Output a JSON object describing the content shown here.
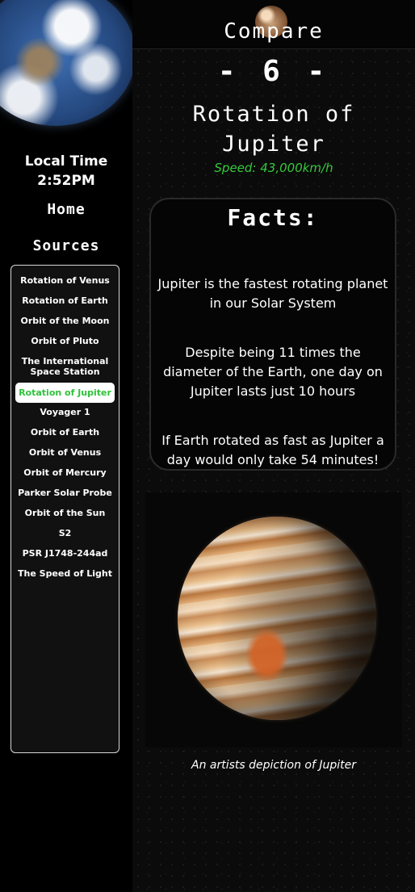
{
  "sidebar": {
    "local_time_label": "Local Time",
    "local_time_value": "2:52PM",
    "home_label": "Home",
    "sources_label": "Sources",
    "sources": [
      "Rotation of Venus",
      "Rotation of Earth",
      "Orbit of the Moon",
      "Orbit of Pluto",
      "The International Space Station",
      "Rotation of Jupiter",
      "Voyager 1",
      "Orbit of Earth",
      "Orbit of Venus",
      "Orbit of Mercury",
      "Parker Solar Probe",
      "Orbit of the Sun",
      "S2",
      "PSR J1748-244ad",
      "The Speed of Light"
    ],
    "active_source": "Rotation of Jupiter",
    "active_color": "#2fc23a"
  },
  "header": {
    "title": "Compare",
    "number": "- 6 -"
  },
  "main": {
    "heading": "Rotation of Jupiter",
    "speed": "Speed: 43,000km/h",
    "speed_color": "#35c93c",
    "facts_title": "Facts:",
    "facts": [
      "Jupiter is the fastest rotating planet in our Solar System",
      "Despite being 11 times the diameter of the Earth, one day on Jupiter lasts just 10 hours",
      "If Earth rotated as fast as Jupiter a day would only take 54 minutes!"
    ],
    "image_caption": "An artists depiction of Jupiter"
  },
  "icons": {
    "earth": "earth-image",
    "pluto": "pluto-image",
    "jupiter": "jupiter-image"
  }
}
